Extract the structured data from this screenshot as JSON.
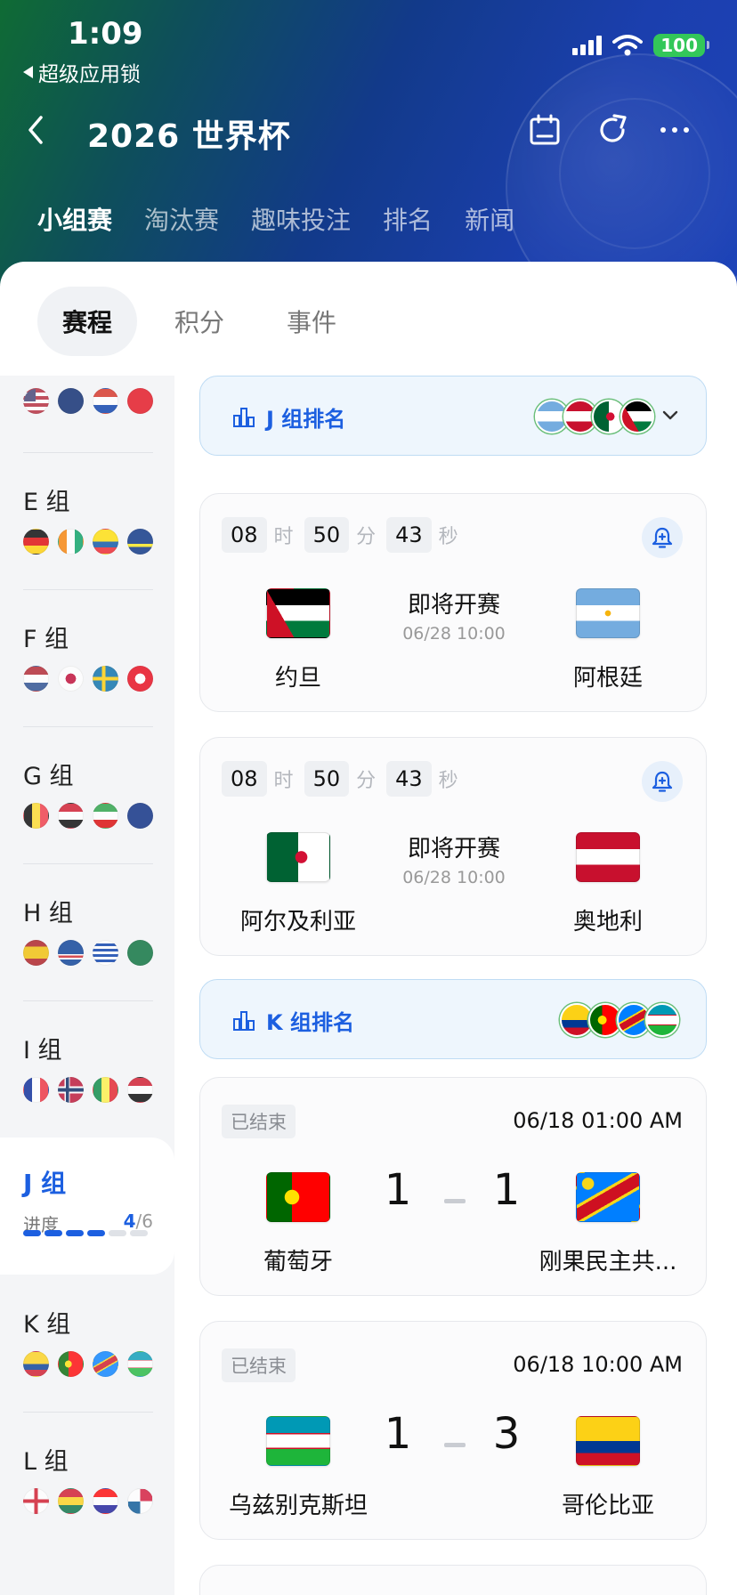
{
  "status_bar": {
    "time": "1:09",
    "back_app": "超级应用锁",
    "battery": "100"
  },
  "nav": {
    "title": "2026 世界杯"
  },
  "top_tabs": [
    "小组赛",
    "淘汰赛",
    "趣味投注",
    "排名",
    "新闻"
  ],
  "sub_tabs": [
    "赛程",
    "积分",
    "事件"
  ],
  "sidebar": {
    "groups": [
      {
        "name": "E 组"
      },
      {
        "name": "F 组"
      },
      {
        "name": "G 组"
      },
      {
        "name": "H 组"
      },
      {
        "name": "I 组"
      },
      {
        "name": "J 组",
        "progress_label": "进度",
        "progress_done": "4",
        "progress_total": "/6"
      },
      {
        "name": "K 组"
      },
      {
        "name": "L 组"
      }
    ]
  },
  "ranking_bars": [
    {
      "label": "J 组排名"
    },
    {
      "label": "K 组排名"
    }
  ],
  "matches": [
    {
      "countdown": {
        "hours": "08",
        "minutes": "50",
        "seconds": "43",
        "h_unit": "时",
        "m_unit": "分",
        "s_unit": "秒"
      },
      "status": "即将开赛",
      "time": "06/28 10:00",
      "home": "约旦",
      "away": "阿根廷"
    },
    {
      "countdown": {
        "hours": "08",
        "minutes": "50",
        "seconds": "43",
        "h_unit": "时",
        "m_unit": "分",
        "s_unit": "秒"
      },
      "status": "即将开赛",
      "time": "06/28 10:00",
      "home": "阿尔及利亚",
      "away": "奥地利"
    },
    {
      "state": "已结束",
      "time": "06/18 01:00 AM",
      "home": "葡萄牙",
      "away": "刚果民主共...",
      "home_score": "1",
      "away_score": "1"
    },
    {
      "state": "已结束",
      "time": "06/18 10:00 AM",
      "home": "乌兹别克斯坦",
      "away": "哥伦比亚",
      "home_score": "1",
      "away_score": "3"
    }
  ],
  "colors": {
    "accent": "#1c5fe0",
    "header_start": "#0f6b34",
    "header_end": "#1d43b8",
    "battery": "#33c759"
  }
}
